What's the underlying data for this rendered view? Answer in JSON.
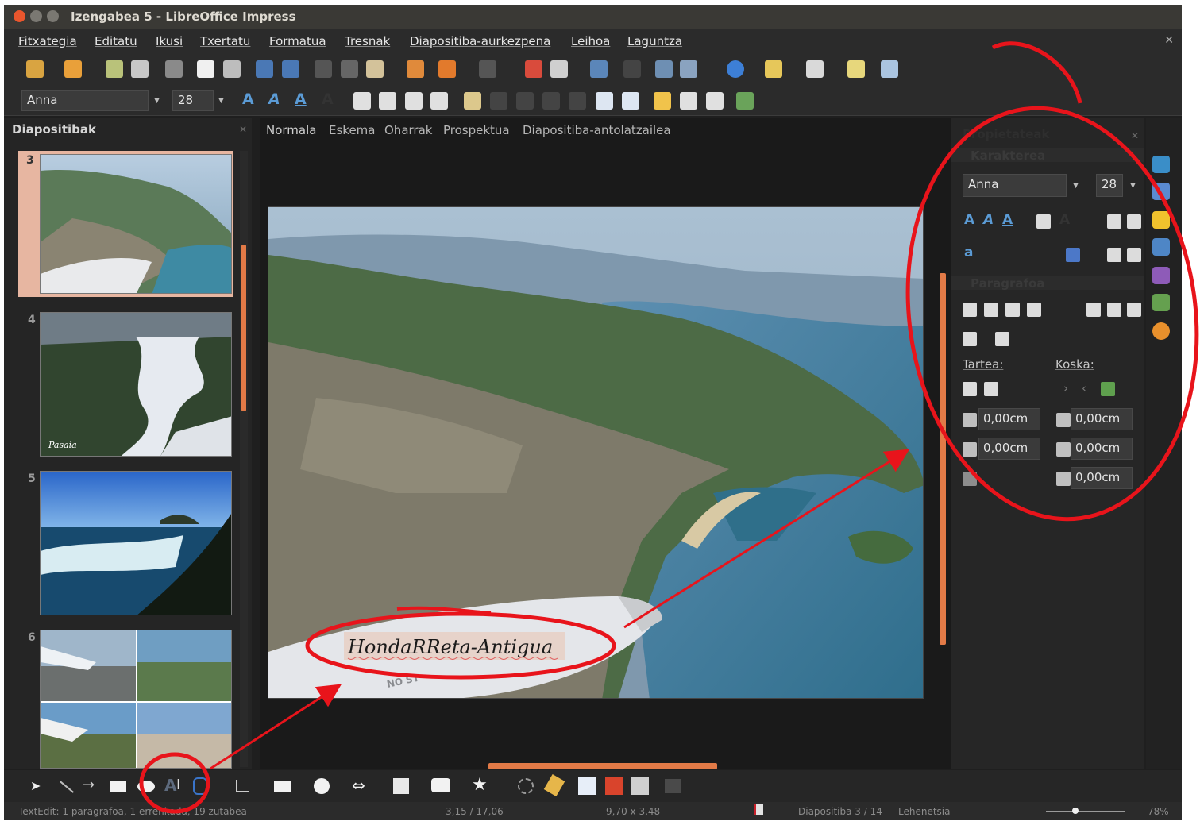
{
  "window": {
    "title": "Izengabea 5 - LibreOffice Impress"
  },
  "menu": [
    "Fitxategia",
    "Editatu",
    "Ikusi",
    "Txertatu",
    "Formatua",
    "Tresnak",
    "Diapositiba-aurkezpena",
    "Leihoa",
    "Laguntza"
  ],
  "toolbar": {
    "font_name": "Anna",
    "font_size": "28"
  },
  "slides_panel": {
    "title": "Diapositibak",
    "slides": [
      {
        "num": "3",
        "caption": ""
      },
      {
        "num": "4",
        "caption": "Pasaia"
      },
      {
        "num": "5",
        "caption": ""
      },
      {
        "num": "6",
        "caption": ""
      }
    ]
  },
  "view_tabs": [
    "Normala",
    "Eskema",
    "Oharrak",
    "Prospektua",
    "Diapositiba-antolatzailea"
  ],
  "slide": {
    "text_box": "HondaRReta-Antigua",
    "wing_text": "NO ST"
  },
  "properties": {
    "title": "Propietateak",
    "character_section": "Karakterea",
    "font_name": "Anna",
    "font_size": "28",
    "paragraph_section": "Paragrafoa",
    "spacing_label": "Tartea:",
    "indent_label": "Koska:",
    "spacing_values": [
      "0,00cm",
      "0,00cm",
      "0,00cm",
      "0,00cm",
      "0,00cm"
    ]
  },
  "status": {
    "text_edit": "TextEdit: 1 paragrafoa, 1 errenkada, 19 zutabea",
    "position": "3,15 / 17,06",
    "size": "9,70 x 3,48",
    "slide_info": "Diapositiba 3 / 14",
    "layout": "Lehenetsia",
    "zoom": "78%"
  },
  "colors": {
    "accent": "#e27a47",
    "annotation": "#e8141b",
    "menu_bg": "#2b2b2b",
    "title_bg": "#3a3935"
  }
}
